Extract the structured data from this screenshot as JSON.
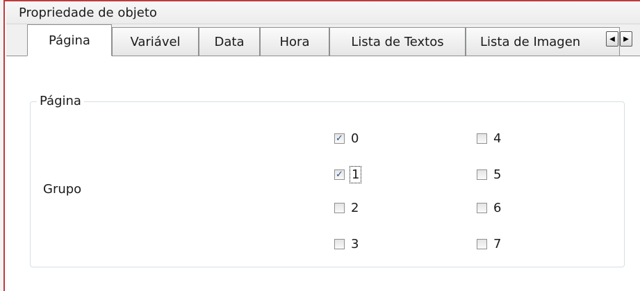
{
  "window": {
    "title": "Propriedade de objeto"
  },
  "tabs": [
    {
      "label": "Página",
      "active": true
    },
    {
      "label": "Variável",
      "active": false
    },
    {
      "label": "Data",
      "active": false
    },
    {
      "label": "Hora",
      "active": false
    },
    {
      "label": "Lista de Textos",
      "active": false
    },
    {
      "label": "Lista de Imagen",
      "active": false
    }
  ],
  "tab_scroll": {
    "left_icon": "arrow-left-icon",
    "right_icon": "arrow-right-icon"
  },
  "panel": {
    "group_title": "Página",
    "grupo_label": "Grupo",
    "checkboxes": [
      {
        "label": "0",
        "checked": true
      },
      {
        "label": "1",
        "checked": true,
        "focused": true
      },
      {
        "label": "2",
        "checked": false
      },
      {
        "label": "3",
        "checked": false
      },
      {
        "label": "4",
        "checked": false
      },
      {
        "label": "5",
        "checked": false
      },
      {
        "label": "6",
        "checked": false
      },
      {
        "label": "7",
        "checked": false
      }
    ]
  },
  "colors": {
    "frame_accent": "#c0393b",
    "check": "#2a4e8a"
  }
}
